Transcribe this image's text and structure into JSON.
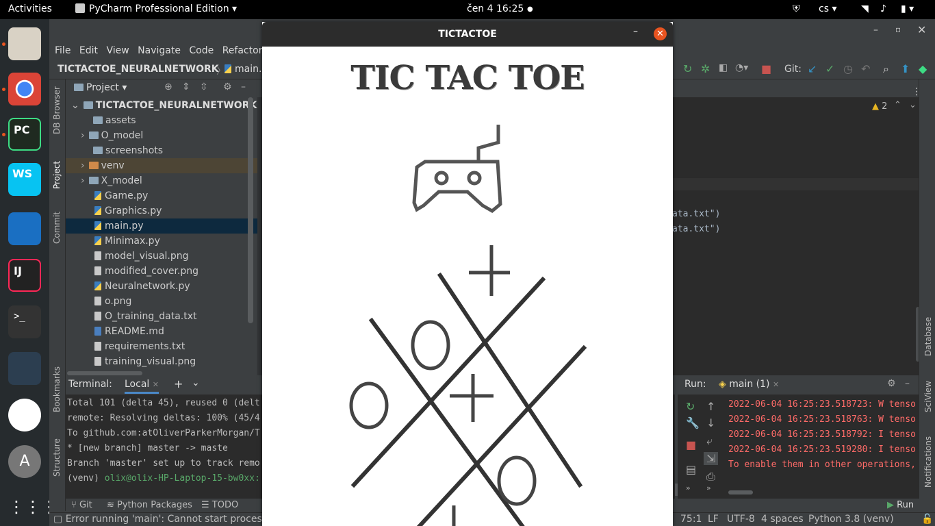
{
  "topbar": {
    "activities": "Activities",
    "app_name": "PyCharm Professional Edition",
    "clock": "čen 4  16:25",
    "lang": "cs"
  },
  "menu": [
    "File",
    "Edit",
    "View",
    "Navigate",
    "Code",
    "Refactor"
  ],
  "breadcrumb": {
    "project": "TICTACTOE_NEURALNETWORK",
    "file": "main.py"
  },
  "toolbar": {
    "git_label": "Git:"
  },
  "project_panel": {
    "title": "Project",
    "root": "TICTACTOE_NEURALNETWORK",
    "items": [
      {
        "name": "assets",
        "type": "folder"
      },
      {
        "name": "O_model",
        "type": "folder"
      },
      {
        "name": "screenshots",
        "type": "folder"
      },
      {
        "name": "venv",
        "type": "folder"
      },
      {
        "name": "X_model",
        "type": "folder"
      },
      {
        "name": "Game.py",
        "type": "py"
      },
      {
        "name": "Graphics.py",
        "type": "py"
      },
      {
        "name": "main.py",
        "type": "py"
      },
      {
        "name": "Minimax.py",
        "type": "py"
      },
      {
        "name": "model_visual.png",
        "type": "file"
      },
      {
        "name": "modified_cover.png",
        "type": "file"
      },
      {
        "name": "Neuralnetwork.py",
        "type": "py"
      },
      {
        "name": "o.png",
        "type": "file"
      },
      {
        "name": "O_training_data.txt",
        "type": "file"
      },
      {
        "name": "README.md",
        "type": "file"
      },
      {
        "name": "requirements.txt",
        "type": "file"
      },
      {
        "name": "training_visual.png",
        "type": "file"
      }
    ]
  },
  "left_tools": [
    "DB Browser",
    "Project",
    "Commit",
    "Bookmarks",
    "Structure"
  ],
  "right_tools": [
    "Database",
    "SciView",
    "Notifications"
  ],
  "editor": {
    "warnings": "2",
    "line1": "ata.txt\")",
    "line2": "ata.txt\")"
  },
  "terminal": {
    "label": "Terminal:",
    "tab": "Local",
    "lines": [
      "Total 101 (delta 45), reused 0 (delt",
      "remote: Resolving deltas: 100% (45/4",
      "To github.com:atOliverParkerMorgan/T",
      " * [new branch]      master -> maste",
      "Branch 'master' set up to track remo",
      "(venv) "
    ],
    "prompt_user": "olix@olix-HP-Laptop-15-bw0xx:"
  },
  "run": {
    "label": "Run:",
    "tab": "main (1)",
    "lines": [
      "2022-06-04 16:25:23.518723: W tenso",
      "2022-06-04 16:25:23.518763: W tenso",
      "2022-06-04 16:25:23.518792: I tenso",
      "2022-06-04 16:25:23.519280: I tenso",
      "To enable them in other operations,"
    ]
  },
  "bottom_tabs": [
    "Git",
    "Python Packages",
    "TODO"
  ],
  "run_button": "Run",
  "status": {
    "message": "Error running 'main': Cannot start process,",
    "position": "75:1",
    "line_sep": "LF",
    "encoding": "UTF-8",
    "indent": "4 spaces",
    "interpreter": "Python 3.8 (venv)"
  },
  "popup": {
    "window_title": "TICTACTOE",
    "game_title": "TIC TAC TOE"
  }
}
